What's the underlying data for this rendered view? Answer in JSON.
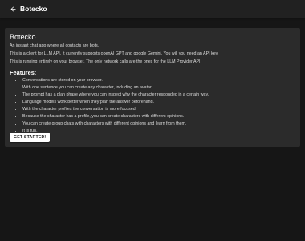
{
  "appbar": {
    "back_icon": "arrow-left-icon",
    "title": "Botecko"
  },
  "colors": {
    "background": "#161616",
    "appbar": "#212121",
    "card": "#2b2b2b",
    "button_bg": "#ffffff",
    "button_text": "#1a1a1a"
  },
  "main": {
    "heading": "Botecko",
    "paragraphs": [
      "An instant chat app where all contacts are bots.",
      "This is a client for LLM API. It currently supports openAI GPT and google Gemini. You will you need an API key.",
      "This is running entirely on your browser. The only network calls are the ones for the LLM Provider API."
    ],
    "features_title": "Features:",
    "features": [
      "Conversations are stored on your browser.",
      "With one sentence you can create any character, including an avatar.",
      "The prompt has a plan phase where you can inspect why the character responded in a certain way.",
      "Language models work better when they plan the answer beforehand.",
      "With the character profiles the conversation is more focused",
      "Because the character has a profile, you can create characters with different opinions.",
      "You can create group chats with characters with different opinions and learn from them.",
      "It is fun."
    ],
    "cta_label": "GET STARTED!"
  }
}
